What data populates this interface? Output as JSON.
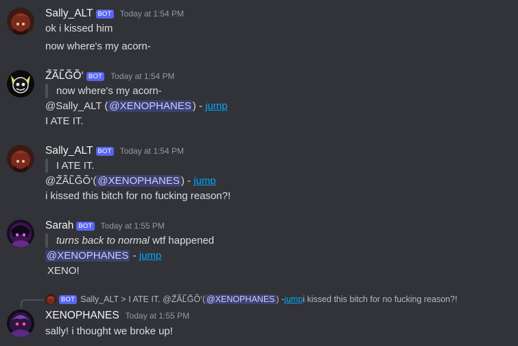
{
  "messages": [
    {
      "author": "Sally_ALT",
      "badge": "BOT",
      "time": "Today at 1:54 PM",
      "lines": [
        "ok i kissed him",
        "now where's my acorn-"
      ]
    },
    {
      "author": "Z̃ÃL̃G̃Õ‘",
      "badge": "BOT",
      "time": "Today at 1:54 PM",
      "quote": "now where's my acorn-",
      "ref_prefix": "@Sally_ALT (",
      "ref_mention": "@XENOPHANES",
      "ref_suffix": ") - ",
      "ref_link": "jump",
      "body": "I ATE IT."
    },
    {
      "author": "Sally_ALT",
      "badge": "BOT",
      "time": "Today at 1:54 PM",
      "quote": "I ATE IT.",
      "ref_prefix": "@Z̃ÃL̃G̃Õ‘(",
      "ref_mention": "@XENOPHANES",
      "ref_suffix": ") - ",
      "ref_link": "jump",
      "body": "i kissed this bitch for no fucking reason?!"
    },
    {
      "author": "Sarah",
      "badge": "BOT",
      "time": "Today at 1:55 PM",
      "quote_em": "turns back to normal",
      "quote_rest": " wtf happened",
      "ref_mention": "@XENOPHANES",
      "ref_suffix": " - ",
      "ref_link": "jump",
      "body": "XENO!"
    },
    {
      "reply": {
        "badge": "BOT",
        "text_a": "Sally_ALT > I ATE IT. @Z̃ÃL̃G̃Õ‘(",
        "mention": "@XENOPHANES",
        "text_b": ") - ",
        "link": "jump",
        "text_c": " i kissed this bitch for no fucking reason?!"
      },
      "author": "XENOPHANES",
      "time": "Today at 1:55 PM",
      "body": "sally! i thought we broke up!"
    }
  ],
  "colors": {
    "background": "#313338",
    "mention_bg": "#3c4270",
    "link": "#00a8fc",
    "bot_badge": "#5865f2"
  },
  "icons": [
    "avatar-sally",
    "avatar-zalgo",
    "avatar-sarah",
    "avatar-xenophanes"
  ]
}
